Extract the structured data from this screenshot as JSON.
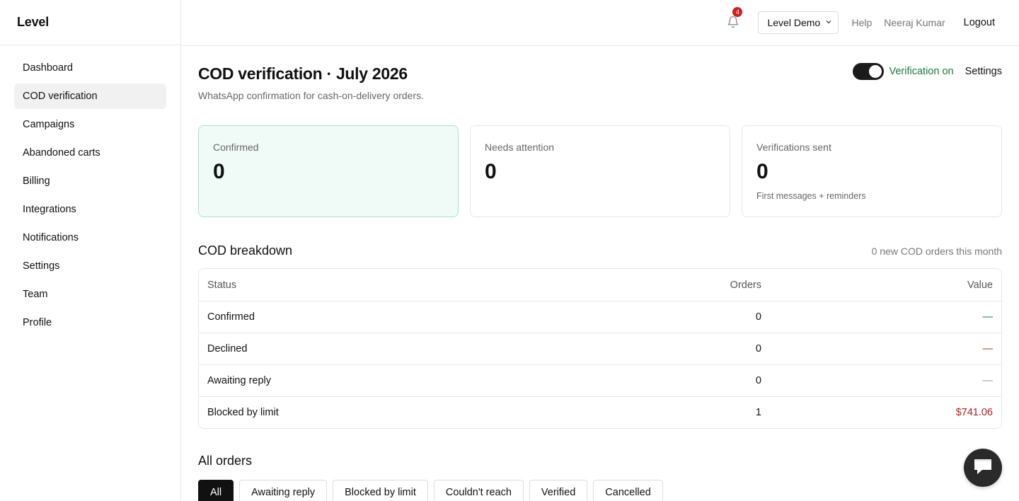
{
  "brand": "Level",
  "sidebar": {
    "items": [
      {
        "label": "Dashboard",
        "active": false
      },
      {
        "label": "COD verification",
        "active": true
      },
      {
        "label": "Campaigns",
        "active": false
      },
      {
        "label": "Abandoned carts",
        "active": false
      },
      {
        "label": "Billing",
        "active": false
      },
      {
        "label": "Integrations",
        "active": false
      },
      {
        "label": "Notifications",
        "active": false
      },
      {
        "label": "Settings",
        "active": false
      },
      {
        "label": "Team",
        "active": false
      },
      {
        "label": "Profile",
        "active": false
      }
    ]
  },
  "topbar": {
    "notification_count": "4",
    "store_selected": "Level Demo",
    "help": "Help",
    "user_name": "Neeraj Kumar",
    "logout": "Logout"
  },
  "page": {
    "title": "COD verification · July 2026",
    "subtitle": "WhatsApp confirmation for cash-on-delivery orders.",
    "verification_status": "Verification on",
    "verification_enabled": true,
    "settings_label": "Settings"
  },
  "cards": [
    {
      "label": "Confirmed",
      "value": "0",
      "note": ""
    },
    {
      "label": "Needs attention",
      "value": "0",
      "note": ""
    },
    {
      "label": "Verifications sent",
      "value": "0",
      "note": "First messages + reminders"
    }
  ],
  "breakdown": {
    "title": "COD breakdown",
    "meta": "0 new COD orders this month",
    "columns": {
      "status": "Status",
      "orders": "Orders",
      "value": "Value"
    },
    "rows": [
      {
        "status": "Confirmed",
        "orders": "0",
        "value": "—"
      },
      {
        "status": "Declined",
        "orders": "0",
        "value": "—"
      },
      {
        "status": "Awaiting reply",
        "orders": "0",
        "value": "—"
      },
      {
        "status": "Blocked by limit",
        "orders": "1",
        "value": "$741.06"
      }
    ]
  },
  "all_orders": {
    "title": "All orders",
    "filters": [
      "All",
      "Awaiting reply",
      "Blocked by limit",
      "Couldn't reach",
      "Verified",
      "Cancelled"
    ],
    "active_filter": "All"
  },
  "colors": {
    "accent_green": "#1a7a3c",
    "declined_red": "#c62828",
    "blocked_value": "#b71c1c",
    "badge_red": "#d81b1b"
  }
}
